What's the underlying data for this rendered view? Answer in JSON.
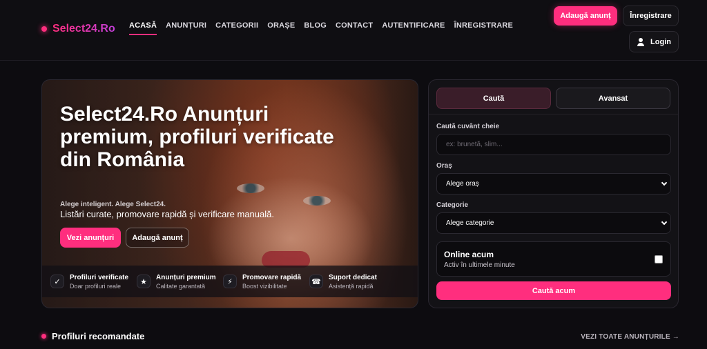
{
  "brand": {
    "name": "Select24.Ro"
  },
  "nav": {
    "items": [
      {
        "label": "ACASĂ",
        "active": true
      },
      {
        "label": "ANUNȚURI"
      },
      {
        "label": "CATEGORII"
      },
      {
        "label": "ORAȘE"
      },
      {
        "label": "BLOG"
      },
      {
        "label": "CONTACT"
      },
      {
        "label": "AUTENTIFICARE"
      },
      {
        "label": "ÎNREGISTRARE"
      }
    ]
  },
  "header_actions": {
    "add_label": "Adaugă anunț",
    "register_label": "Înregistrare",
    "login_label": "Login",
    "login_icon": "user-icon"
  },
  "hero": {
    "title": "Select24.Ro Anunțuri premium, profiluri verificate din România",
    "tagline": "Alege inteligent. Alege Select24.",
    "subtitle": "Listări curate, promovare rapidă și verificare manuală.",
    "primary_cta": "Vezi anunțuri",
    "secondary_cta": "Adaugă anunț",
    "features": [
      {
        "icon": "check-icon",
        "glyph": "✓",
        "title": "Profiluri verificate",
        "subtitle": "Doar profiluri reale"
      },
      {
        "icon": "star-icon",
        "glyph": "★",
        "title": "Anunțuri premium",
        "subtitle": "Calitate garantată"
      },
      {
        "icon": "bolt-icon",
        "glyph": "⚡",
        "title": "Promovare rapidă",
        "subtitle": "Boost vizibilitate"
      },
      {
        "icon": "support-icon",
        "glyph": "☎",
        "title": "Suport dedicat",
        "subtitle": "Asistență rapidă"
      }
    ]
  },
  "search": {
    "tabs": [
      {
        "label": "Caută",
        "active": true
      },
      {
        "label": "Avansat"
      }
    ],
    "keyword_label": "Caută cuvânt cheie",
    "keyword_placeholder": "ex: brunetă, slim...",
    "city_label": "Oraș",
    "city_value": "Alege oraș",
    "category_label": "Categorie",
    "category_value": "Alege categorie",
    "online_title": "Online acum",
    "online_subtitle": "Activ în ultimele minute",
    "online_checked": false,
    "submit_label": "Caută acum"
  },
  "section": {
    "title": "Profiluri recomandate",
    "link_label": "VEZI TOATE ANUNȚURILE →"
  },
  "colors": {
    "accent": "#ff2e7e",
    "background": "#0d0c10",
    "panel": "#131216"
  }
}
